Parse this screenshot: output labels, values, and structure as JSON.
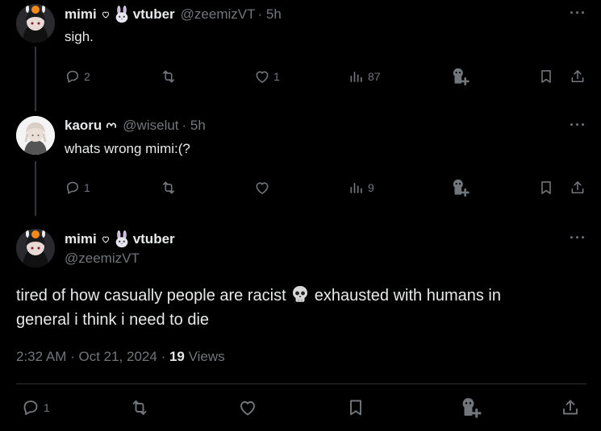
{
  "posts": [
    {
      "display_name_a": "mimi",
      "display_name_b": "vtuber",
      "handle": "@zeemizVT",
      "time": "· 5h",
      "text": "sigh.",
      "replies": "2",
      "reposts": "",
      "likes": "1",
      "views": "87"
    },
    {
      "display_name": "kaoru",
      "handle": "@wiselut",
      "time": "· 5h",
      "text": "whats wrong mimi:(?",
      "replies": "1",
      "reposts": "",
      "likes": "",
      "views": "9"
    }
  ],
  "main_post": {
    "display_name_a": "mimi",
    "display_name_b": "vtuber",
    "handle": "@zeemizVT",
    "text_line1_a": "tired of how casually people are racist",
    "text_line1_b": "exhausted with humans in",
    "text_line2": "general i think i need to die",
    "timestamp": "2:32 AM · Oct 21, 2024 ·",
    "views_count": "19",
    "views_label": "Views",
    "replies": "1"
  },
  "colors": {
    "background": "#000000",
    "text": "#e7e9ea",
    "muted": "#71767b",
    "divider": "#2f3336"
  }
}
